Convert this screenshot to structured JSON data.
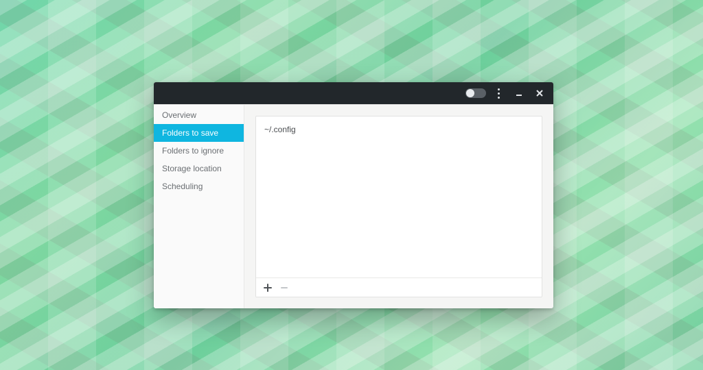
{
  "colors": {
    "titlebar_bg": "#22272b",
    "accent": "#0fb6e0",
    "sidebar_text": "#6a6e72"
  },
  "titlebar": {
    "toggle_state": "off",
    "menu_tooltip": "Menu",
    "minimize_tooltip": "Minimize",
    "close_tooltip": "Close"
  },
  "sidebar": {
    "items": [
      {
        "label": "Overview",
        "active": false
      },
      {
        "label": "Folders to save",
        "active": true
      },
      {
        "label": "Folders to ignore",
        "active": false
      },
      {
        "label": "Storage location",
        "active": false
      },
      {
        "label": "Scheduling",
        "active": false
      }
    ]
  },
  "folders": {
    "items": [
      {
        "path": "~/.config"
      }
    ]
  },
  "toolbar": {
    "add_label": "Add",
    "remove_label": "Remove",
    "remove_enabled": false
  }
}
